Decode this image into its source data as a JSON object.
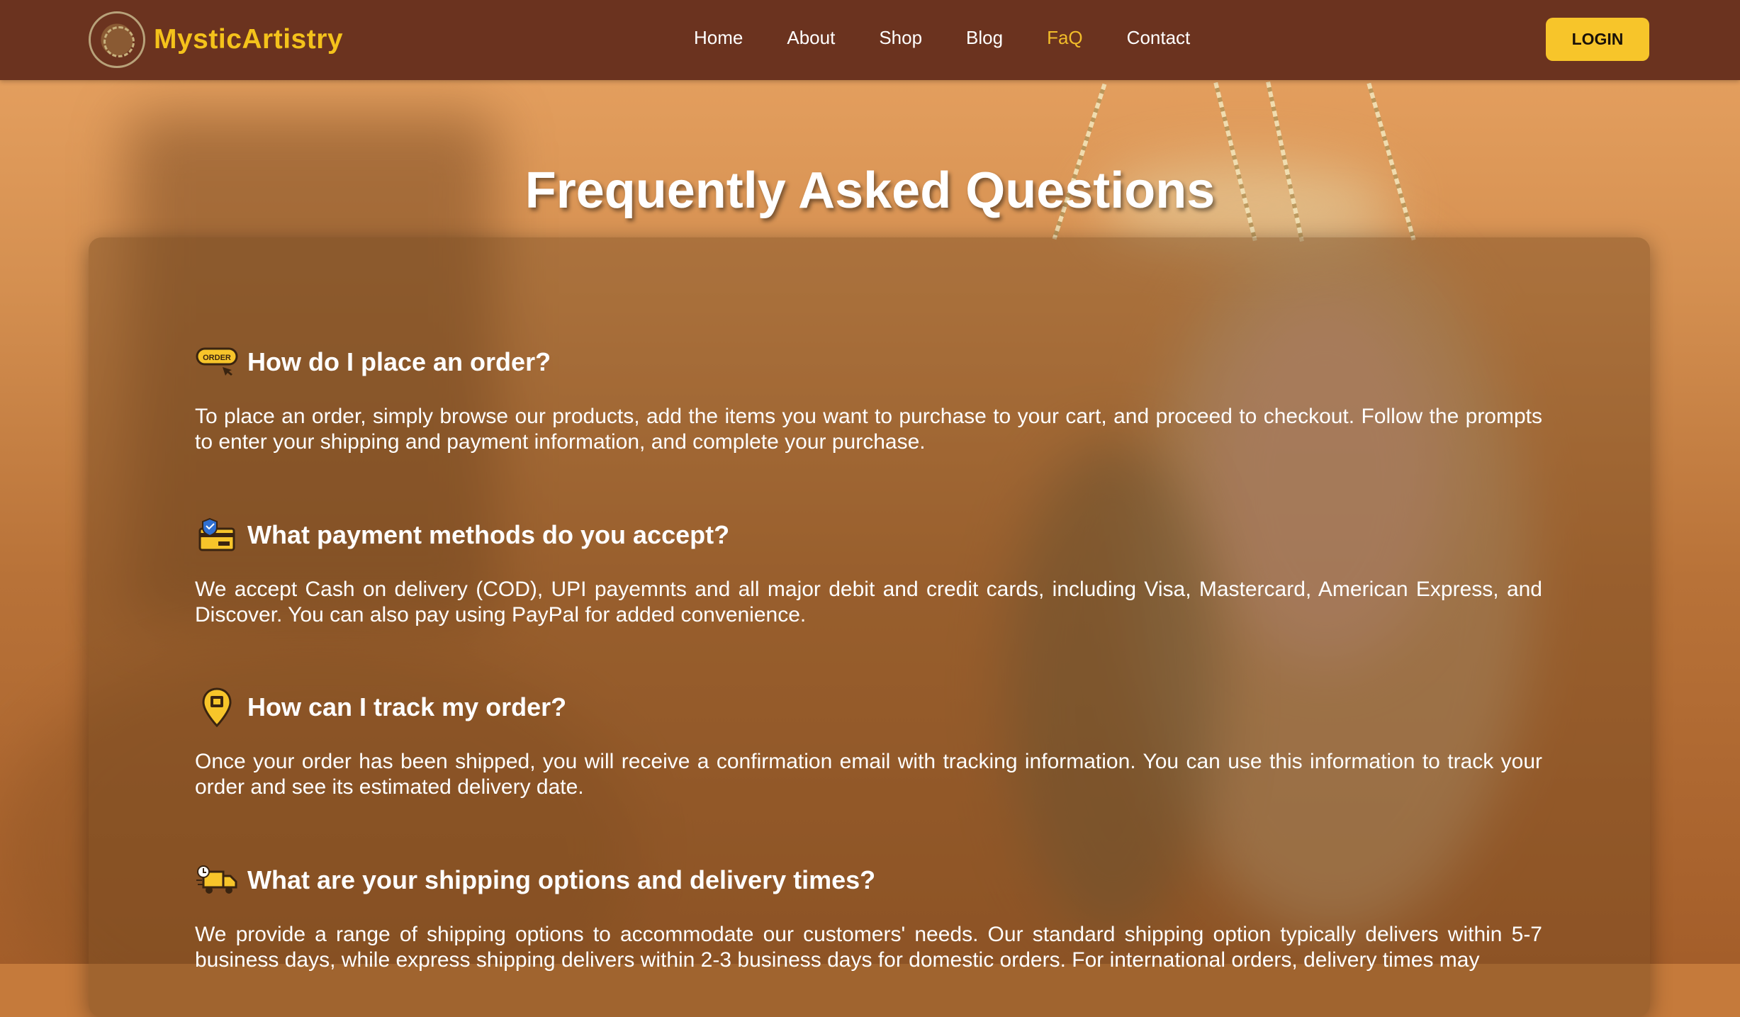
{
  "brand": {
    "name": "MysticArtistry"
  },
  "nav": {
    "items": [
      {
        "label": "Home"
      },
      {
        "label": "About"
      },
      {
        "label": "Shop"
      },
      {
        "label": "Blog"
      },
      {
        "label": "FaQ"
      },
      {
        "label": "Contact"
      }
    ],
    "active": "FaQ",
    "login_label": "LOGIN"
  },
  "page": {
    "title": "Frequently Asked Questions"
  },
  "faqs": [
    {
      "icon": "order-tag-icon",
      "icon_text": "ORDER",
      "question": "How do I place an order?",
      "answer": "To place an order, simply browse our products, add the items you want to purchase to your cart, and proceed to checkout. Follow the prompts to enter your shipping and payment information, and complete your purchase."
    },
    {
      "icon": "payment-card-icon",
      "question": "What payment methods do you accept?",
      "answer": "We accept Cash on delivery (COD), UPI payemnts and all major debit and credit cards, including Visa, Mastercard, American Express, and Discover. You can also pay using PayPal for added convenience."
    },
    {
      "icon": "location-pin-icon",
      "question": "How can I track my order?",
      "answer": "Once your order has been shipped, you will receive a confirmation email with tracking information. You can use this information to track your order and see its estimated delivery date."
    },
    {
      "icon": "delivery-truck-icon",
      "question": "What are your shipping options and delivery times?",
      "answer": "We provide a range of shipping options to accommodate our customers' needs. Our standard shipping option typically delivers within 5-7 business days, while express shipping delivers within 2-3 business days for domestic orders. For international orders, delivery times may"
    }
  ],
  "colors": {
    "nav_bg": "#6b331f",
    "brand": "#f4c21b",
    "active_link": "#f2bd2a",
    "login_bg": "#f7c52a"
  }
}
